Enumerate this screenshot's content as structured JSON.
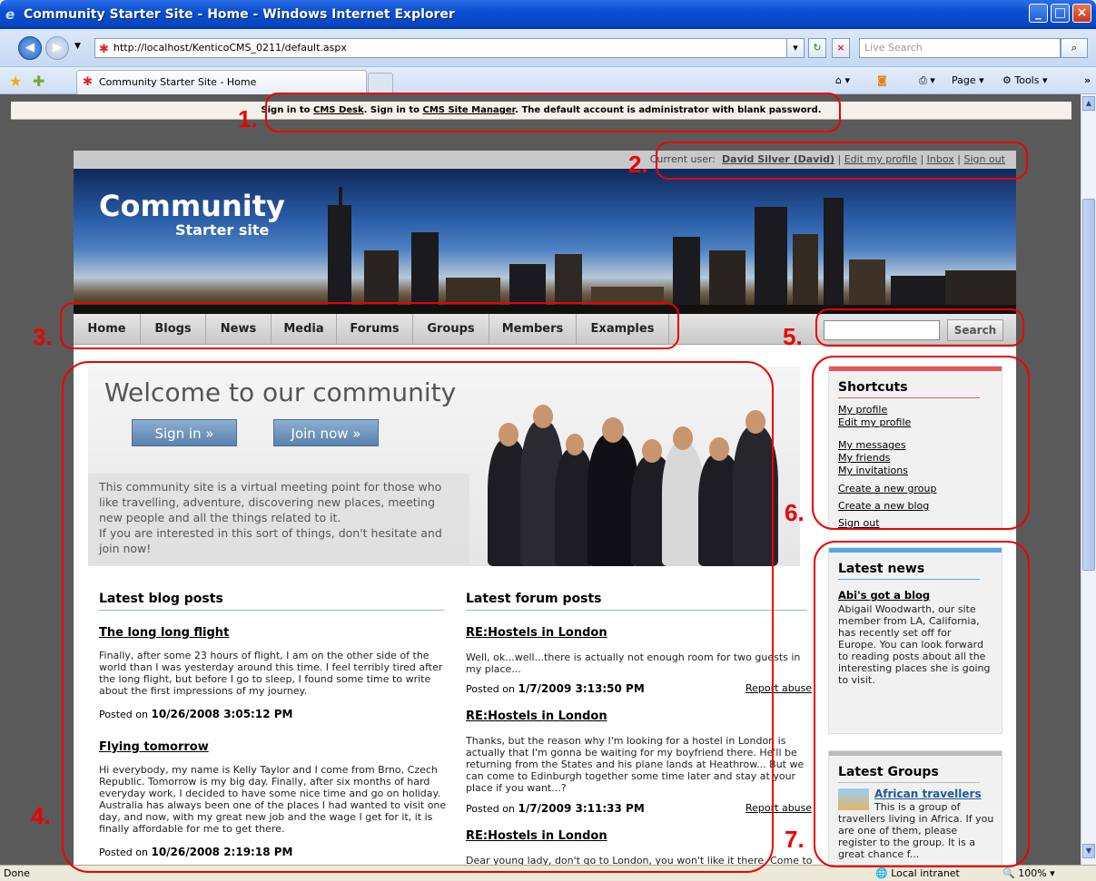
{
  "window": {
    "title": "Community Starter Site - Home - Windows Internet Explorer"
  },
  "browser": {
    "address": "http://localhost/KenticoCMS_0211/default.aspx",
    "search_placeholder": "Live Search",
    "tab_title": "Community Starter Site - Home",
    "commands": {
      "page": "Page",
      "tools": "Tools"
    },
    "status": "Done",
    "zone": "Local intranet",
    "zoom": "100%"
  },
  "cms_bar": {
    "prefix": "Sign in to ",
    "desk": "CMS Desk",
    "mid": ". Sign in to ",
    "manager": "CMS Site Manager",
    "suffix": ". The default account is administrator with blank password."
  },
  "user_bar": {
    "label": "Current user:",
    "user": "David Silver (David)",
    "edit": "Edit my profile",
    "inbox": "Inbox",
    "signout": "Sign out"
  },
  "logo": {
    "title": "Community",
    "subtitle": "Starter site"
  },
  "nav": [
    "Home",
    "Blogs",
    "News",
    "Media",
    "Forums",
    "Groups",
    "Members",
    "Examples"
  ],
  "search": {
    "button": "Search"
  },
  "welcome": {
    "heading": "Welcome to our community",
    "signin": "Sign in »",
    "join": "Join now »",
    "text": "This community site is a virtual meeting point for those who like travelling, adventure, discovering new places, meeting new people and all the things related to it.",
    "text2": "If you are interested in this sort of things, don't hesitate and join now!"
  },
  "blog": {
    "heading": "Latest blog posts",
    "posts": [
      {
        "title": "The long long flight",
        "text": "Finally, after some 23 hours of flight, I am on the other side of the world than I was yesterday around this time. I feel terribly tired after the long flight, but before I go to sleep, I found some time to write about the first impressions of my journey.",
        "posted": "Posted on",
        "date": "10/26/2008 3:05:12 PM"
      },
      {
        "title": "Flying tomorrow",
        "text": "Hi everybody, my name is Kelly Taylor and I come from Brno, Czech Republic. Tomorrow is my big day. Finally, after six months of hard everyday work, I decided to have some nice time and go on holiday. Australia has always been one of the places I had wanted to visit one day, and now, with my great new job and the wage I get for it, it is finally affordable for me to get there.",
        "posted": "Posted on",
        "date": "10/26/2008 2:19:18 PM"
      }
    ]
  },
  "forum": {
    "heading": "Latest forum posts",
    "report": "Report abuse",
    "posts": [
      {
        "title": "RE:Hostels in London",
        "text": "Well, ok...well...there is actually not enough room for two guests in my place...",
        "posted": "Posted on",
        "date": "1/7/2009 3:13:50 PM"
      },
      {
        "title": "RE:Hostels in London",
        "text": "Thanks, but the reason why I'm looking for a hostel in London is actually that I'm gonna be waiting for my boyfriend there. He'll be returning from the States and his plane lands at Heathrow... But we can come to Edinburgh together some time later and stay at your place if you want...?",
        "posted": "Posted on",
        "date": "1/7/2009 3:11:33 PM"
      },
      {
        "title": "RE:Hostels in London",
        "text": "Dear young lady, don't go to London, you won't like it there. Come to"
      }
    ]
  },
  "shortcuts": {
    "heading": "Shortcuts",
    "links": [
      "My profile",
      "Edit my profile",
      "My messages",
      "My friends",
      "My invitations",
      "Create a new group",
      "Create a new blog",
      "Sign out"
    ]
  },
  "news": {
    "heading": "Latest news",
    "title": "Abi's got a blog",
    "text": "Abigail Woodwarth, our site member from LA, California, has recently set off for Europe. You can look forward to reading posts about all the interesting places she is going to visit."
  },
  "groups": {
    "heading": "Latest Groups",
    "title": "African travellers",
    "text": "This is a group of travellers living in Africa. If you are one of them, please register to the group. It is a great chance f..."
  },
  "annotations": [
    "1.",
    "2.",
    "3.",
    "4.",
    "5.",
    "6.",
    "7."
  ]
}
